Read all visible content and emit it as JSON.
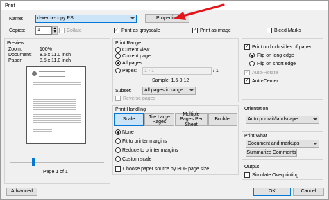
{
  "window": {
    "title": "Print"
  },
  "printer": {
    "name_label": "Name:",
    "name_value": "d-xerox-copy PS",
    "properties_button": "Properties",
    "copies_label": "Copies:",
    "copies_value": "1",
    "collate_label": "Collate",
    "grayscale_label": "Print as grayscale",
    "image_label": "Print as image",
    "bleed_label": "Bleed Marks"
  },
  "preview": {
    "title": "Preview",
    "zoom_label": "Zoom:",
    "zoom_value": "100%",
    "document_label": "Document:",
    "document_value": "8.5 x 11.0 inch",
    "paper_label": "Paper:",
    "paper_value": "8.5 x 11.0 inch",
    "page_indicator": "Page 1 of 1"
  },
  "print_range": {
    "title": "Print Range",
    "current_view": "Current view",
    "current_page": "Current page",
    "all_pages": "All pages",
    "pages_label": "Pages:",
    "pages_value": "1 - 1",
    "pages_total": "/ 1",
    "sample": "Sample: 1,5-9,12",
    "subset_label": "Subset:",
    "subset_value": "All pages in range",
    "reverse_pages": "Reverse pages"
  },
  "print_handling": {
    "title": "Print Handling",
    "tabs": [
      "Scale",
      "Tile Large Pages",
      "Multiple Pages Per Sheet",
      "Booklet"
    ],
    "options": [
      "None",
      "Fit to printer margins",
      "Reduce to printer margins",
      "Custom scale"
    ],
    "paper_source": "Choose paper source by PDF page size"
  },
  "duplex": {
    "both_sides": "Print on both sides of paper",
    "flip_long": "Flip on long edge",
    "flip_short": "Flip on short edge",
    "auto_rotate": "Auto-Rotate",
    "auto_center": "Auto-Center"
  },
  "orientation": {
    "title": "Orientation",
    "value": "Auto portrait/landscape"
  },
  "print_what": {
    "title": "Print What",
    "value": "Document and markups",
    "summarize_button": "Summarize Comments"
  },
  "output": {
    "title": "Output",
    "simulate": "Simulate Overprinting"
  },
  "footer": {
    "advanced": "Advanced",
    "ok": "OK",
    "cancel": "Cancel"
  },
  "colors": {
    "annotation_arrow": "#e3141a",
    "accent": "#0078d7"
  }
}
